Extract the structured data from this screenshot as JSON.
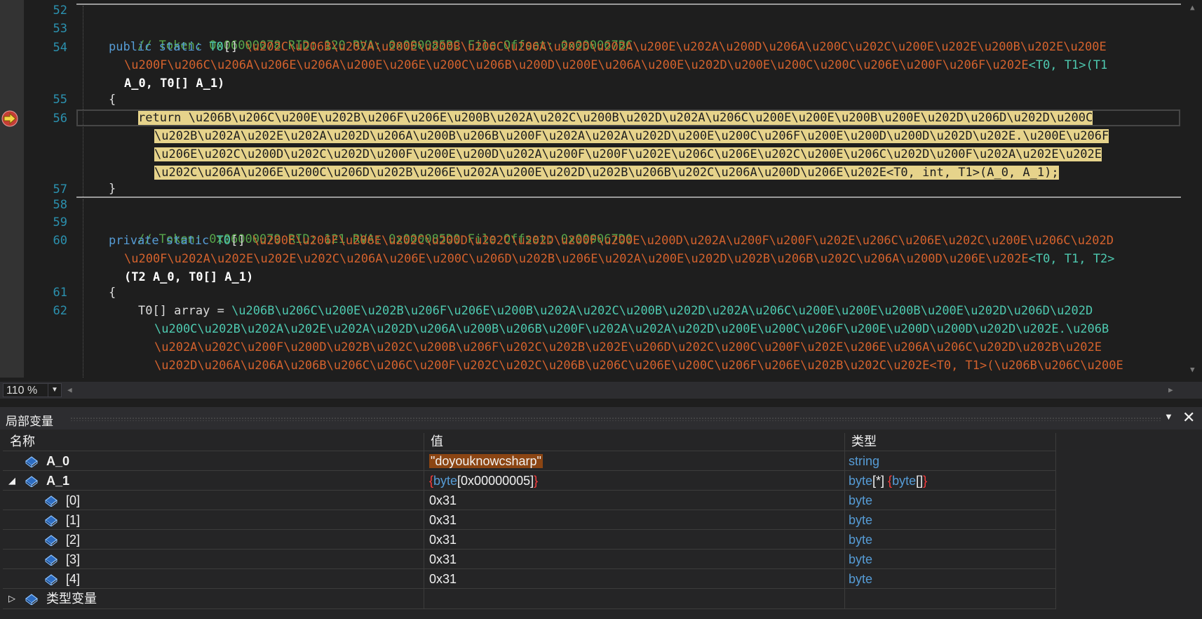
{
  "editor": {
    "line_numbers": [
      "52",
      "53",
      "54",
      "55",
      "56",
      "57",
      "58",
      "59",
      "60",
      "61",
      "62"
    ],
    "lines": {
      "l53_comment": "// Token: 0x06000078 RID: 120 RVA: 0x000085BC File Offset: 0x000067BC",
      "l54_kw": "public static",
      "l54_type": "T0",
      "l54_brackets": "[]",
      "l54_name1": "\\u202C\\u206B\\u202A\\u200E\\u200B\\u206C\\u206A\\u202D\\u202A\\u200E\\u202A\\u200D\\u206A\\u200C\\u202C\\u200E\\u202E\\u200B\\u202E\\u200E",
      "l54_name2": "\\u200F\\u206C\\u206A\\u206E\\u206A\\u200E\\u206E\\u200C\\u206B\\u200D\\u200E\\u206A\\u200E\\u202D\\u200E\\u200C\\u200C\\u206E\\u200F\\u206F\\u202E",
      "l54_generic": "<T0, T1>(T1",
      "l54_params": "A_0, T0[] A_1)",
      "l55_brace": "{",
      "l56_a": "return \\u206B\\u206C\\u200E\\u202B\\u206F\\u206E\\u200B\\u202A\\u202C\\u200B\\u202D\\u202A\\u206C\\u200E\\u200E\\u200B\\u200E\\u202D\\u206D\\u202D\\u200C",
      "l56_b": "\\u202B\\u202A\\u202E\\u202A\\u202D\\u206A\\u200B\\u206B\\u200F\\u202A\\u202A\\u202D\\u200E\\u200C\\u206F\\u200E\\u200D\\u200D\\u202D\\u202E.\\u200E\\u206F",
      "l56_c": "\\u206E\\u202C\\u200D\\u202C\\u202D\\u200F\\u200E\\u200D\\u202A\\u200F\\u200F\\u202E\\u206C\\u206E\\u202C\\u200E\\u206C\\u202D\\u200F\\u202A\\u202E\\u202E",
      "l56_d": "\\u202C\\u206A\\u206E\\u200C\\u206D\\u202B\\u206E\\u202A\\u200E\\u202D\\u202B\\u206B\\u202C\\u206A\\u200D\\u206E\\u202E<T0, int, T1>(A_0, A_1);",
      "l57_brace": "}",
      "l59_comment": "// Token: 0x06000079 RID: 121 RVA: 0x000085D0 File Offset: 0x000067D0",
      "l60_kw": "private static",
      "l60_type": "T0",
      "l60_brackets": "[]",
      "l60_name1": "\\u200E\\u206F\\u206E\\u202C\\u200D\\u202C\\u202D\\u200F\\u200E\\u200D\\u202A\\u200F\\u200F\\u202E\\u206C\\u206E\\u202C\\u200E\\u206C\\u202D",
      "l60_name2": "\\u200F\\u202A\\u202E\\u202E\\u202C\\u206A\\u206E\\u200C\\u206D\\u202B\\u206E\\u202A\\u200E\\u202D\\u202B\\u206B\\u202C\\u206A\\u200D\\u206E\\u202E",
      "l60_generic": "<T0, T1, T2>",
      "l60_params": "(T2 A_0, T0[] A_1)",
      "l61_brace": "{",
      "l62_start": "T0[] array = ",
      "l62_name1": "\\u206B\\u206C\\u200E\\u202B\\u206F\\u206E\\u200B\\u202A\\u202C\\u200B\\u202D\\u202A\\u206C\\u200E\\u200E\\u200B\\u200E\\u202D\\u206D\\u202D",
      "l62_name2": "\\u200C\\u202B\\u202A\\u202E\\u202A\\u202D\\u206A\\u200B\\u206B\\u200F\\u202A\\u202A\\u202D\\u200E\\u200C\\u206F\\u200E\\u200D\\u200D\\u202D\\u202E.\\u206B",
      "l62_name3": "\\u202A\\u202C\\u200F\\u200D\\u202B\\u202C\\u200B\\u206F\\u202C\\u202B\\u202E\\u206D\\u202C\\u200C\\u200F\\u202E\\u206E\\u206A\\u206C\\u202D\\u202B\\u202E",
      "l62_name4": "\\u202D\\u206A\\u206A\\u206B\\u206C\\u206C\\u200F\\u202C\\u202C\\u206B\\u206C\\u206E\\u200C\\u206F\\u206E\\u202B\\u202C\\u202E<T0, T1>(\\u206B\\u206C\\u200E"
    }
  },
  "zoom": {
    "value": "110 %"
  },
  "locals": {
    "title": "局部变量",
    "columns": {
      "name": "名称",
      "value": "值",
      "type": "类型"
    },
    "rows": {
      "a0": {
        "name": "A_0",
        "value": "\"doyouknowcsharp\"",
        "type": "string"
      },
      "a1": {
        "name": "A_1",
        "value_open": "{",
        "value_type": "byte",
        "value_rest": "[0x00000005]",
        "value_close": "}",
        "type_a": "byte",
        "type_b": "[*] ",
        "type_open": "{",
        "type_c": "byte",
        "type_d": "[]",
        "type_close": "}"
      },
      "e0": {
        "name": "[0]",
        "value": "0x31",
        "type": "byte"
      },
      "e1": {
        "name": "[1]",
        "value": "0x31",
        "type": "byte"
      },
      "e2": {
        "name": "[2]",
        "value": "0x31",
        "type": "byte"
      },
      "e3": {
        "name": "[3]",
        "value": "0x31",
        "type": "byte"
      },
      "e4": {
        "name": "[4]",
        "value": "0x31",
        "type": "byte"
      },
      "tv": {
        "name": "类型变量"
      }
    }
  },
  "icons": [
    "breakpoint-arrow-icon",
    "variable-icon",
    "expand-triangle-icon",
    "collapse-triangle-icon",
    "close-icon",
    "dropdown-icon"
  ],
  "colors": {
    "highlight": "#e6d38b",
    "comment": "#57a64a",
    "keyword": "#569cd6",
    "obfuscated_identifier": "#d4622d",
    "type_param": "#4ec9b0",
    "line_number": "#2b91af",
    "string_value_bg": "#8b4513"
  }
}
